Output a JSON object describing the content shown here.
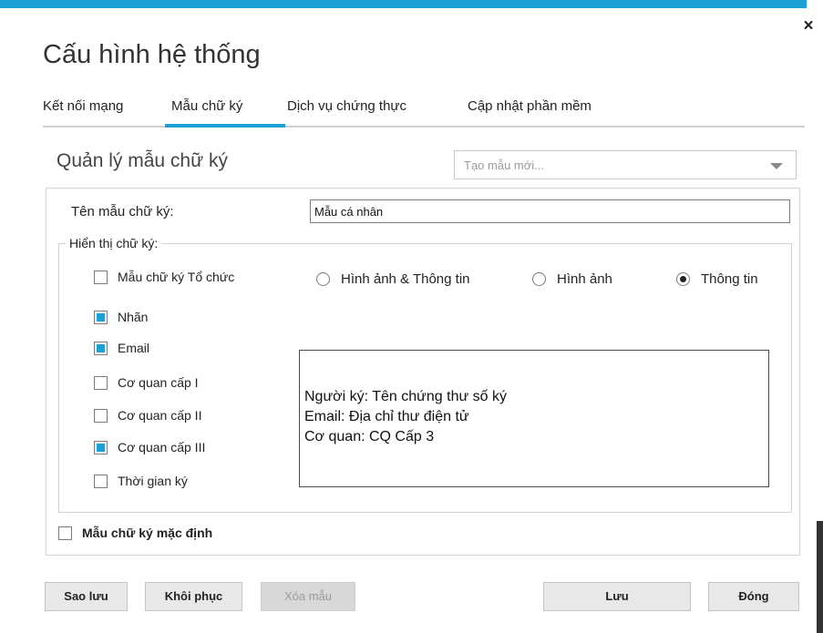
{
  "window": {
    "title": "Cấu hình hệ thống",
    "close_label": "×"
  },
  "tabs": [
    {
      "label": "Kết nối mạng"
    },
    {
      "label": "Mẫu chữ ký"
    },
    {
      "label": "Dịch vụ chứng thực"
    },
    {
      "label": "Cập nhật phần mềm"
    }
  ],
  "active_tab": "Mẫu chữ ký",
  "section": {
    "title": "Quản lý mẫu chữ ký",
    "template_dropdown": {
      "placeholder": "Tạo mẫu mới..."
    }
  },
  "form": {
    "name_label": "Tên mẫu chữ ký:",
    "name_value": "Mẫu cá nhân",
    "display_label": "Hiển thị chữ ký:",
    "org_template": {
      "label": "Mẫu chữ ký Tổ chức",
      "checked": false
    },
    "display_modes": [
      {
        "label": "Hình ảnh & Thông tin",
        "selected": false
      },
      {
        "label": "Hình ảnh",
        "selected": false
      },
      {
        "label": "Thông tin",
        "selected": true
      }
    ],
    "fields": [
      {
        "label": "Nhãn",
        "checked": true
      },
      {
        "label": "Email",
        "checked": true
      },
      {
        "label": "Cơ quan cấp I",
        "checked": false
      },
      {
        "label": "Cơ quan cấp II",
        "checked": false
      },
      {
        "label": "Cơ quan cấp III",
        "checked": true
      },
      {
        "label": "Thời gian ký",
        "checked": false
      }
    ],
    "preview_lines": [
      "Người ký: Tên chứng thư số ký",
      "Email: Địa chỉ thư điện tử",
      "Cơ quan: CQ Cấp 3"
    ],
    "default_template": {
      "label": "Mẫu chữ ký mặc định",
      "checked": false
    }
  },
  "buttons": {
    "backup": "Sao lưu",
    "restore": "Khôi phục",
    "delete": "Xóa mẫu",
    "save": "Lưu",
    "close": "Đóng"
  },
  "colors": {
    "accent": "#1ba1d6"
  }
}
